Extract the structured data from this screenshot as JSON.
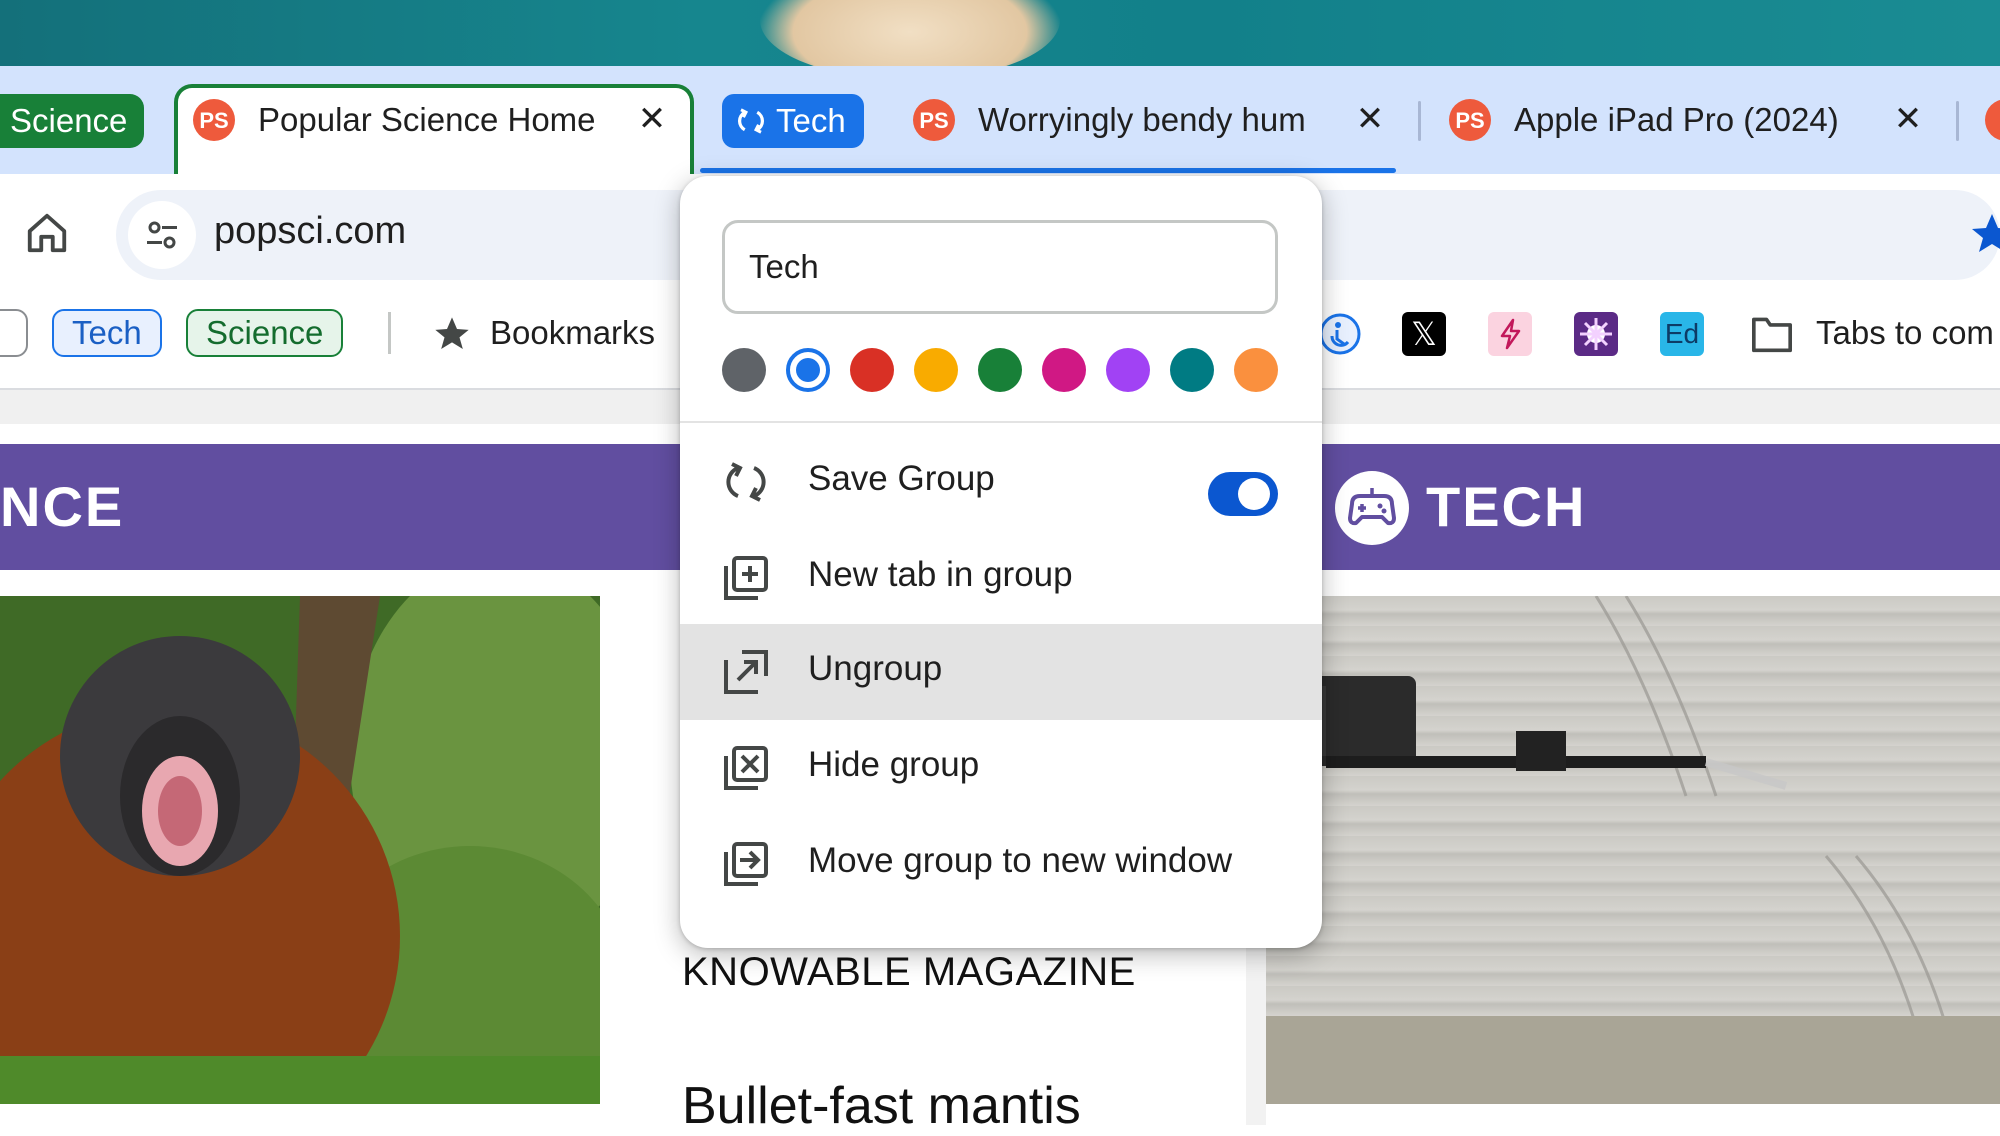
{
  "tabs": {
    "science_group": "Science",
    "active_tab_title": "Popular Science Home",
    "tech_group": "Tech",
    "tab2_title": "Worryingly bendy hum",
    "tab3_title": "Apple iPad Pro (2024)"
  },
  "toolbar": {
    "url": "popsci.com"
  },
  "bookmarks": {
    "tech_chip": "Tech",
    "science_chip": "Science",
    "bookmarks_label": "Bookmarks",
    "ed_label": "Ed",
    "tabs_folder": "Tabs to com"
  },
  "page": {
    "banner_left": "NCE",
    "banner_right": "TECH",
    "source": "KNOWABLE MAGAZINE",
    "headline": "Bullet-fast mantis"
  },
  "popup": {
    "group_name": "Tech",
    "colors": [
      "#5f6368",
      "#1a73e8",
      "#d93025",
      "#f9ab00",
      "#188038",
      "#d01884",
      "#a142f4",
      "#007b83",
      "#fa903e"
    ],
    "selected_color": "#1a73e8",
    "menu": {
      "save_group": "Save Group",
      "new_tab": "New tab in group",
      "ungroup": "Ungroup",
      "hide_group": "Hide group",
      "move_group": "Move group to new window"
    },
    "save_group_enabled": true
  }
}
